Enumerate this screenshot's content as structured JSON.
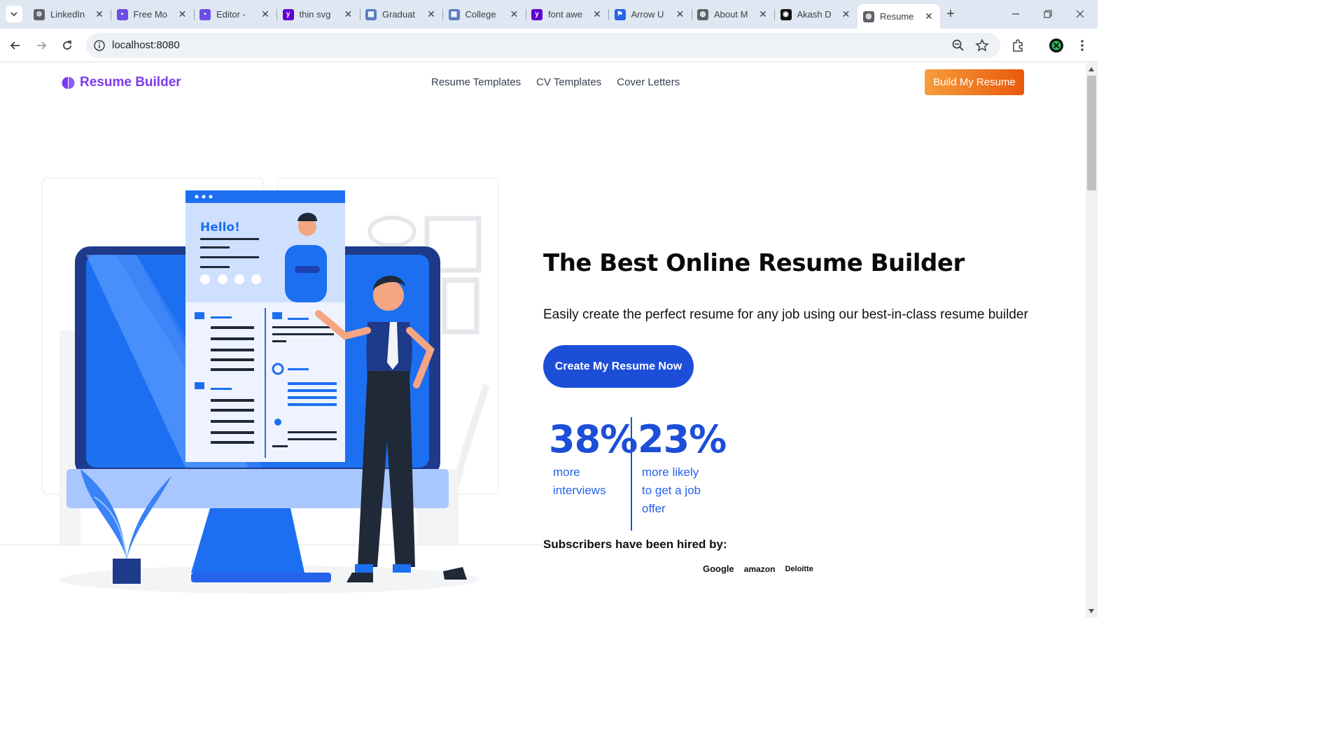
{
  "browser": {
    "tabs": [
      {
        "title": "LinkedIn",
        "favicon": "linkedin-icon",
        "color": "#5f6368"
      },
      {
        "title": "Free Mo",
        "favicon": "puzzle-icon",
        "color": "#6c4ee6"
      },
      {
        "title": "Editor -",
        "favicon": "puzzle-icon",
        "color": "#6c4ee6"
      },
      {
        "title": "thin svg",
        "favicon": "yahoo-icon",
        "color": "#6001d2"
      },
      {
        "title": "Graduat",
        "favicon": "resume-icon",
        "color": "#5b7fbf"
      },
      {
        "title": "College",
        "favicon": "resume-icon",
        "color": "#5b7fbf"
      },
      {
        "title": "font awe",
        "favicon": "yahoo-icon",
        "color": "#6001d2"
      },
      {
        "title": "Arrow U",
        "favicon": "flag-icon",
        "color": "#2563eb"
      },
      {
        "title": "About M",
        "favicon": "globe-icon",
        "color": "#5f6368"
      },
      {
        "title": "Akash D",
        "favicon": "dark-app-icon",
        "color": "#111111"
      },
      {
        "title": "Resume",
        "favicon": "globe-icon",
        "color": "#5f6368",
        "active": true
      }
    ],
    "url": "localhost:8080"
  },
  "site": {
    "brand": "Resume Builder",
    "nav": [
      "Resume Templates",
      "CV Templates",
      "Cover Letters"
    ],
    "top_cta": "Build My Resume",
    "hero_title": "The Best Online Resume Builder",
    "hero_subtitle": "Easily create the perfect resume for any job using our best-in-class resume builder",
    "main_cta": "Create My Resume Now",
    "stats": [
      {
        "value": "38%",
        "label_lines": [
          "more",
          "interviews"
        ]
      },
      {
        "value": "23%",
        "label_lines": [
          "more likely",
          "to get a job",
          "offer"
        ]
      }
    ],
    "hired_title": "Subscribers have been hired by:",
    "companies": [
      "Google",
      "amazon",
      "Deloitte"
    ],
    "illustration_text": "Hello!",
    "brand_color": "#7c3aed",
    "accent_color": "#1d4ed8",
    "cta_color": "#ea580c"
  }
}
